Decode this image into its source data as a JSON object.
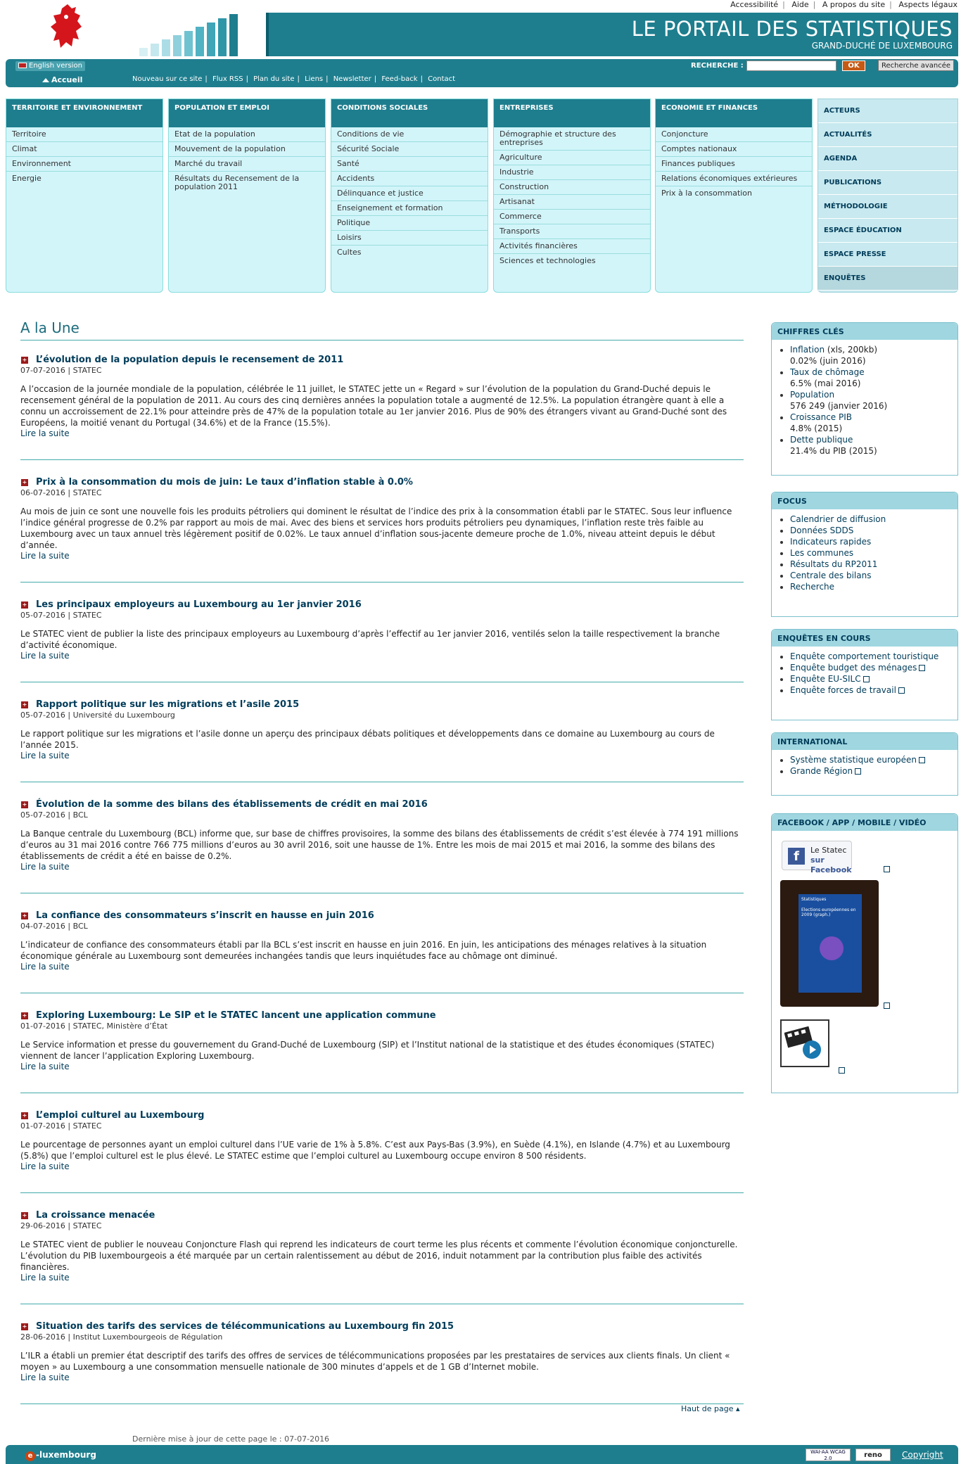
{
  "top_links": [
    "Accessibilité",
    "Aide",
    "A propos du site",
    "Aspects légaux"
  ],
  "banner": {
    "title": "LE PORTAIL DES STATISTIQUES",
    "subtitle": "GRAND-DUCHÉ DE LUXEMBOURG"
  },
  "toolbar": {
    "english": "English version",
    "search_label": "RECHERCHE :",
    "search_value": "",
    "ok": "OK",
    "advanced": "Recherche avancée"
  },
  "secondary": {
    "home": "Accueil",
    "links": [
      "Nouveau sur ce site",
      "Flux RSS",
      "Plan du site",
      "Liens",
      "Newsletter",
      "Feed-back",
      "Contact"
    ]
  },
  "categories": [
    {
      "title": "TERRITOIRE ET ENVIRONNEMENT",
      "items": [
        "Territoire",
        "Climat",
        "Environnement",
        "Energie"
      ]
    },
    {
      "title": "POPULATION ET EMPLOI",
      "items": [
        "Etat de la population",
        "Mouvement de la population",
        "Marché du travail",
        "Résultats du Recensement de la population 2011"
      ]
    },
    {
      "title": "CONDITIONS SOCIALES",
      "items": [
        "Conditions de vie",
        "Sécurité Sociale",
        "Santé",
        "Accidents",
        "Délinquance et justice",
        "Enseignement et formation",
        "Politique",
        "Loisirs",
        "Cultes"
      ]
    },
    {
      "title": "ENTREPRISES",
      "items": [
        "Démographie et structure des entreprises",
        "Agriculture",
        "Industrie",
        "Construction",
        "Artisanat",
        "Commerce",
        "Transports",
        "Activités financières",
        "Sciences et technologies"
      ]
    },
    {
      "title": "ECONOMIE ET FINANCES",
      "items": [
        "Conjoncture",
        "Comptes nationaux",
        "Finances publiques",
        "Relations économiques extérieures",
        "Prix à la consommation"
      ]
    }
  ],
  "side_menu": [
    "ACTEURS",
    "ACTUALITÉS",
    "AGENDA",
    "PUBLICATIONS",
    "MÉTHODOLOGIE",
    "ESPACE ÉDUCATION",
    "ESPACE PRESSE",
    "ENQUÊTES"
  ],
  "main": {
    "heading": "A la Une",
    "read_more": "Lire la suite",
    "news": [
      {
        "title": "L’évolution de la population depuis le recensement de 2011",
        "meta": "07-07-2016 | STATEC",
        "body": "A l’occasion de la journée mondiale de la population, célébrée le 11 juillet, le STATEC jette un « Regard » sur l’évolution de la population du Grand-Duché depuis le recensement général de la population de 2011. Au cours des cinq dernières années la population totale a augmenté de 12.5%. La population étrangère quant à elle a connu un accroissement de 22.1% pour atteindre près de 47% de la population totale au 1er janvier 2016. Plus de 90% des étrangers vivant au Grand-Duché sont des Européens, la moitié venant du Portugal (34.6%) et de la France (15.5%)."
      },
      {
        "title": "Prix à la consommation du mois de juin: Le taux d’inflation stable à 0.0%",
        "meta": "06-07-2016 | STATEC",
        "body": "Au mois de juin ce sont une nouvelle fois les produits pétroliers qui dominent le résultat de l’indice des prix à la consommation établi par le STATEC. Sous leur influence l’indice général progresse de 0.2% par rapport au mois de mai. Avec des biens et services hors produits pétroliers peu dynamiques, l’inflation reste très faible au Luxembourg avec un taux annuel très légèrement positif de 0.02%. Le taux annuel d’inflation sous-jacente demeure proche de 1.0%, niveau atteint depuis le début d’année."
      },
      {
        "title": "Les principaux employeurs au Luxembourg au 1er janvier 2016",
        "meta": "05-07-2016 | STATEC",
        "body": "Le STATEC vient de publier la liste des principaux employeurs au Luxembourg d’après l’effectif au 1er janvier 2016, ventilés selon la taille respectivement la branche d’activité économique."
      },
      {
        "title": "Rapport politique sur les migrations et l’asile 2015",
        "meta": "05-07-2016 | Université du Luxembourg",
        "body": "Le rapport politique sur les migrations et l’asile donne un aperçu des principaux débats politiques et développements dans ce domaine au Luxembourg au cours de l’année 2015."
      },
      {
        "title": "Évolution de la somme des bilans des établissements de crédit en mai 2016",
        "meta": "05-07-2016 | BCL",
        "body": "La Banque centrale du Luxembourg (BCL) informe que, sur base de chiffres provisoires, la somme des bilans des établissements de crédit s’est élevée à 774 191 millions d’euros au 31 mai 2016 contre 766 775 millions d’euros au 30 avril 2016, soit une hausse de 1%. Entre les mois de mai 2015 et mai 2016, la somme des bilans des établissements de crédit a été en baisse de 0.2%."
      },
      {
        "title": "La confiance des consommateurs s’inscrit en hausse en juin 2016",
        "meta": "04-07-2016 | BCL",
        "body": "L’indicateur de confiance des consommateurs établi par lla BCL s’est inscrit en hausse en juin 2016. En juin, les anticipations des ménages relatives à la situation économique générale au Luxembourg sont demeurées inchangées tandis que leurs inquiétudes face au chômage ont diminué."
      },
      {
        "title": "Exploring Luxembourg: Le SIP et le STATEC lancent une application commune",
        "meta": "01-07-2016 | STATEC, Ministère d’État",
        "body": "Le Service information et presse du gouvernement du Grand-Duché de Luxembourg (SIP) et l’Institut national de la statistique et des études économiques (STATEC) viennent de lancer l’application Exploring Luxembourg."
      },
      {
        "title": "L’emploi culturel au Luxembourg",
        "meta": "01-07-2016 | STATEC",
        "body": "Le pourcentage de personnes ayant un emploi culturel dans l’UE varie de 1% à 5.8%. C’est aux Pays-Bas (3.9%), en Suède (4.1%), en Islande (4.7%) et au Luxembourg (5.8%) que l’emploi culturel est le plus élevé. Le STATEC estime que l’emploi culturel au Luxembourg occupe environ 8 500 résidents."
      },
      {
        "title": "La croissance menacée",
        "meta": "29-06-2016 | STATEC",
        "body": "Le STATEC vient de publier le nouveau Conjoncture Flash qui reprend les indicateurs de court terme les plus récents et commente l’évolution économique conjoncturelle. L’évolution du PIB luxembourgeois a été marquée par un certain ralentissement au début de 2016, induit notamment par la contribution plus faible des activités financières."
      },
      {
        "title": "Situation des tarifs des services de télécommunications au Luxembourg fin 2015",
        "meta": "28-06-2016 | Institut Luxembourgeois de Régulation",
        "body": "L’ILR a établi un premier état descriptif des tarifs des offres de services de télécommunications proposées par les prestataires de services aux clients finals. Un client « moyen » au Luxembourg a une consommation mensuelle nationale de 300 minutes d’appels et de 1 GB d’Internet mobile."
      }
    ],
    "back_to_top": "Haut de page",
    "last_update": "Dernière mise à jour de cette page le : 07-07-2016"
  },
  "chiffres": {
    "title": "CHIFFRES CLÉS",
    "items": [
      {
        "label": "Inflation",
        "extra": " (xls, 200kb)",
        "value": "0.02% (juin 2016)"
      },
      {
        "label": "Taux de chômage",
        "extra": "",
        "value": "6.5% (mai 2016)"
      },
      {
        "label": "Population",
        "extra": "",
        "value": "576 249 (janvier 2016)"
      },
      {
        "label": "Croissance PIB",
        "extra": "",
        "value": "4.8% (2015)"
      },
      {
        "label": "Dette publique",
        "extra": "",
        "value": "21.4% du PIB (2015)"
      }
    ]
  },
  "focus": {
    "title": "FOCUS",
    "items": [
      "Calendrier de diffusion",
      "Données SDDS",
      "Indicateurs rapides",
      "Les communes",
      "Résultats du RP2011",
      "Centrale des bilans",
      "Recherche"
    ]
  },
  "enquetes": {
    "title": "ENQUÊTES EN COURS",
    "items": [
      "Enquête comportement touristique",
      "Enquête budget des ménages",
      "Enquête EU-SILC",
      "Enquête forces de travail"
    ]
  },
  "international": {
    "title": "INTERNATIONAL",
    "items": [
      "Système statistique européen",
      "Grande Région"
    ]
  },
  "social": {
    "title": "FACEBOOK / APP / MOBILE / VIDÉO",
    "fb_line1": "Le Statec",
    "fb_line2": "sur Facebook",
    "phone_header": "Statistiques",
    "phone_title": "Elections européennes en 2009 (graph.)"
  },
  "footer": {
    "elux": "-luxembourg",
    "wai": "WAI-AA WCAG 2.0",
    "reno": "reno",
    "copyright": "Copyright"
  }
}
